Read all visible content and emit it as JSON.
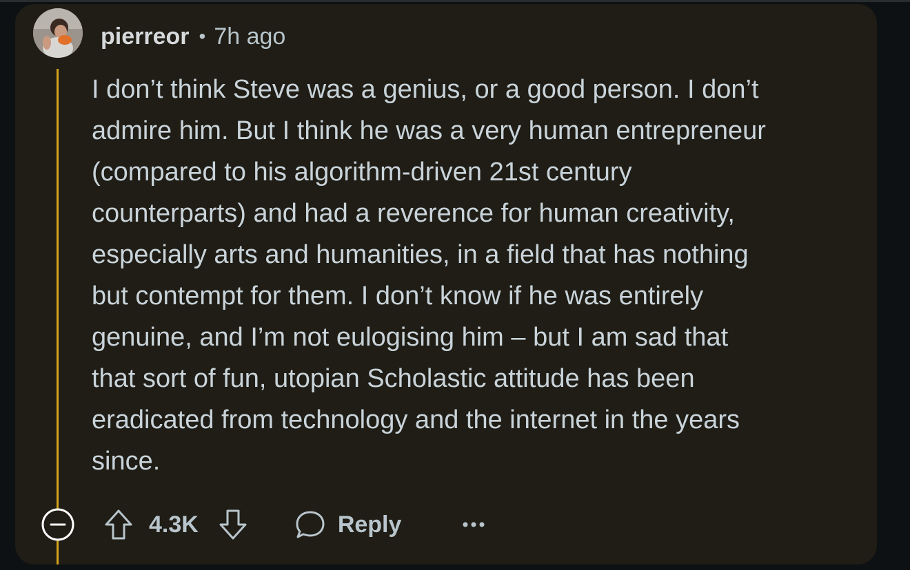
{
  "comment": {
    "author": "pierreor",
    "separator": "•",
    "timestamp": "7h ago",
    "text": "I don’t think Steve was a genius, or a good person. I don’t\nadmire him. But I think he was a very human entrepreneur\n(compared to his algorithm-driven 21st century\ncounterparts) and had a reverence for human creativity,\nespecially arts and humanities, in a field that has nothing\nbut contempt for them. I don’t know if he was entirely\ngenuine, and I’m not eulogising him – but I am sad that\nthat sort of fun, utopian Scholastic attitude has been\neradicated from technology and the internet in the years\nsince."
  },
  "actions": {
    "score": "4.3K",
    "reply_label": "Reply"
  },
  "icons": {
    "collapse": "minus-circle-icon",
    "upvote": "arrow-up-outline-icon",
    "downvote": "arrow-down-outline-icon",
    "reply": "speech-bubble-icon",
    "more": "ellipsis-icon"
  },
  "colors": {
    "background": "#0e1113",
    "card": "#1f1d15",
    "thread_line": "#d3a21c",
    "text": "#c9d3da",
    "meta_text": "#b8c5cc"
  }
}
